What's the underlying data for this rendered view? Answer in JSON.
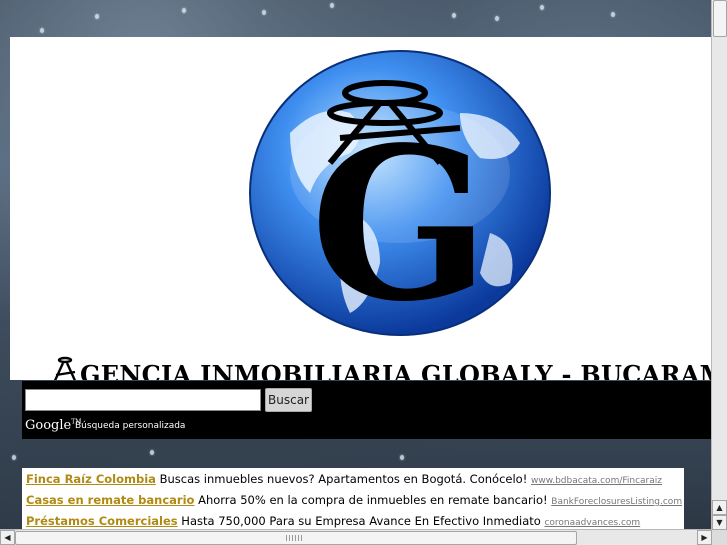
{
  "banner": {
    "title": "GENCIA INMOBILIARIA GLOBALY -   BUCARAMANGA",
    "logo_letter": "G",
    "logo_icon": "globe-g-logo-icon",
    "globe_color": "#1a5fd1"
  },
  "search": {
    "input_value": "",
    "button_label": "Buscar",
    "google_label": "Google",
    "google_tm": "TM",
    "custom_search_label": "Búsqueda personalizada"
  },
  "ads": [
    {
      "link": "Finca Raíz Colombia",
      "text": " Buscas inmuebles nuevos? Apartamentos en Bogotá. Conócelo! ",
      "url": "www.bdbacata.com/Fincaraiz"
    },
    {
      "link": "Casas en remate bancario",
      "text": " Ahorra 50% en la compra de inmuebles en remate bancario! ",
      "url": "BankForeclosuresListing.com"
    },
    {
      "link": "Préstamos Comerciales",
      "text": " Hasta 750,000 Para su Empresa Avance En Efectivo Inmediato ",
      "url": "coronaadvances.com"
    }
  ],
  "colors": {
    "ad_link": "#b08a12",
    "search_bar_bg": "#000000"
  },
  "scrollbars": {
    "up_arrow": "▲",
    "down_arrow": "▼",
    "left_arrow": "◀",
    "right_arrow": "▶"
  }
}
